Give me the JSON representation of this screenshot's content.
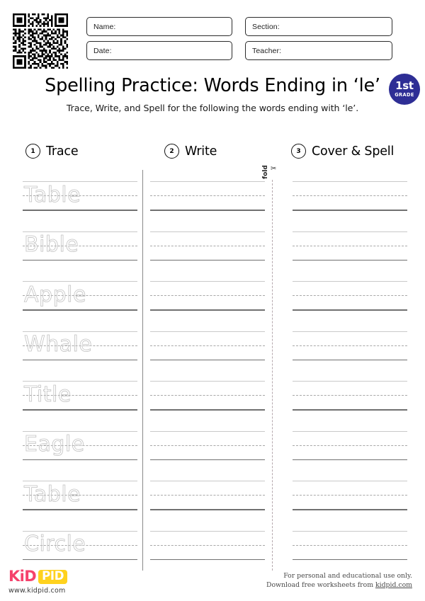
{
  "header": {
    "qr_icon": "qr-code",
    "fields": [
      {
        "label": "Name:",
        "value": ""
      },
      {
        "label": "Section:",
        "value": ""
      },
      {
        "label": "Date:",
        "value": ""
      },
      {
        "label": "Teacher:",
        "value": ""
      }
    ]
  },
  "title": {
    "heading": "Spelling Practice: Words Ending in ‘le’",
    "subheading": "Trace, Write, and Spell for the following the words ending with ‘le’.",
    "badge_top": "1st",
    "badge_bottom": "GRADE",
    "badge_color": "#2e2e95"
  },
  "columns": [
    {
      "number": "1",
      "label": "Trace"
    },
    {
      "number": "2",
      "label": "Write"
    },
    {
      "number": "3",
      "label": "Cover & Spell"
    }
  ],
  "fold": {
    "label": "fold",
    "scissors_icon": "scissors-icon"
  },
  "words": [
    "Table",
    "Bible",
    "Apple",
    "Whale",
    "Title",
    "Eagle",
    "Table",
    "Circle"
  ],
  "footer": {
    "logo_kid": "KiD",
    "logo_pid": "PID",
    "logo_url": "www.kidpid.com",
    "legal_line1": "For personal and educational use only.",
    "legal_line2_prefix": "Download free worksheets from ",
    "legal_link": "kidpid.com"
  }
}
